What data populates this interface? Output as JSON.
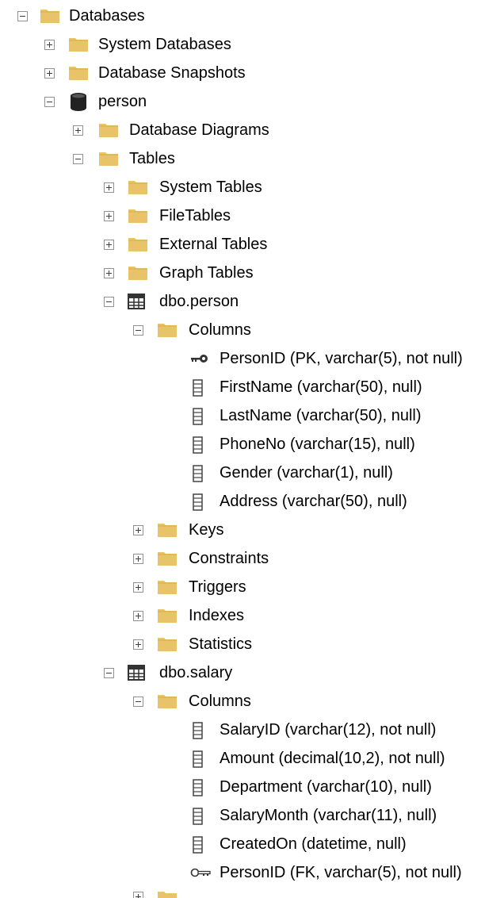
{
  "tree": {
    "databases": "Databases",
    "system_databases": "System Databases",
    "database_snapshots": "Database Snapshots",
    "person_db": "person",
    "database_diagrams": "Database Diagrams",
    "tables": "Tables",
    "system_tables": "System Tables",
    "file_tables": "FileTables",
    "external_tables": "External Tables",
    "graph_tables": "Graph Tables",
    "person_table": {
      "name": "dbo.person",
      "columns_label": "Columns",
      "columns": [
        "PersonID (PK, varchar(5), not null)",
        "FirstName (varchar(50), null)",
        "LastName (varchar(50), null)",
        "PhoneNo (varchar(15), null)",
        "Gender (varchar(1), null)",
        "Address (varchar(50), null)"
      ],
      "keys": "Keys",
      "constraints": "Constraints",
      "triggers": "Triggers",
      "indexes": "Indexes",
      "statistics": "Statistics"
    },
    "salary_table": {
      "name": "dbo.salary",
      "columns_label": "Columns",
      "columns": [
        "SalaryID (varchar(12), not null)",
        "Amount (decimal(10,2), not null)",
        "Department (varchar(10), null)",
        "SalaryMonth (varchar(11), null)",
        "CreatedOn (datetime, null)",
        "PersonID (FK, varchar(5), not null)"
      ]
    }
  },
  "colors": {
    "folder": "#E8C36A",
    "folder_dark": "#D9AE4B",
    "toggle_border": "#919191",
    "icon_gray": "#444444"
  }
}
